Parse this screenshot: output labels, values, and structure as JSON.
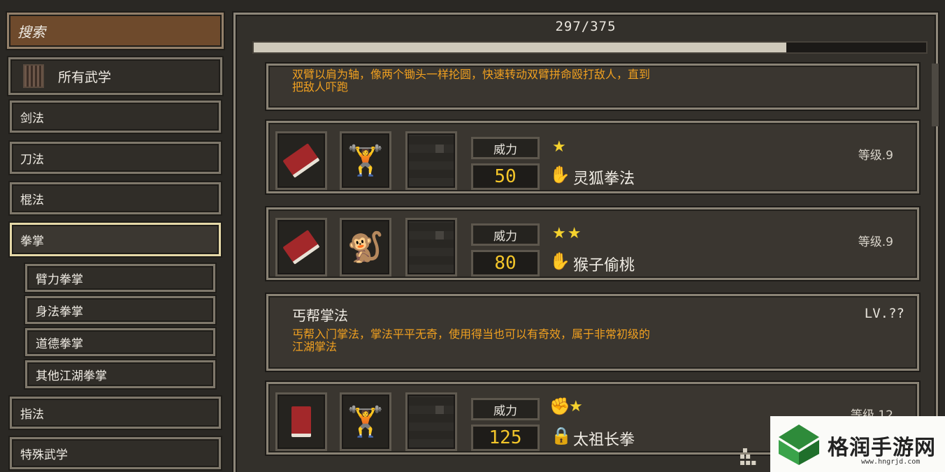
{
  "sidebar": {
    "search": "搜索",
    "all": "所有武学",
    "items": [
      "剑法",
      "刀法",
      "棍法",
      "拳掌"
    ],
    "sub_items": [
      "臂力拳掌",
      "身法拳掌",
      "道德拳掌",
      "其他江湖拳掌"
    ],
    "bottom_items": [
      "指法",
      "特殊武学"
    ]
  },
  "progress": {
    "text": "297/375",
    "fraction": 0.792
  },
  "top_card": {
    "desc_line1": "双臂以肩为轴，像两个锄头一样抡圆，快速转动双臂拼命殴打敌人，直到",
    "desc_line2": "把敌人吓跑"
  },
  "cards": [
    {
      "label": "威力",
      "value": "50",
      "stars": "★",
      "name": "灵狐拳法",
      "level": "等级.9",
      "figure_icon": "muscle-figure"
    },
    {
      "label": "威力",
      "value": "80",
      "stars": "★★",
      "name": "猴子偷桃",
      "level": "等级.9",
      "figure_icon": "monkey-figure"
    }
  ],
  "info_card": {
    "title": "丐帮掌法",
    "lv": "LV.??",
    "desc_line1": "丐帮入门掌法，掌法平平无奇，使用得当也可以有奇效，属于非常初级的",
    "desc_line2": "江湖掌法"
  },
  "card3": {
    "label": "威力",
    "value": "125",
    "stars": "★",
    "name": "太祖长拳",
    "level": "等级.12"
  },
  "watermark": {
    "text": "格润手游网",
    "url": "www.hngrjd.com"
  },
  "colors": {
    "accent_orange": "#f0a020",
    "value_yellow": "#f4c62a",
    "star": "#f5d22e"
  }
}
